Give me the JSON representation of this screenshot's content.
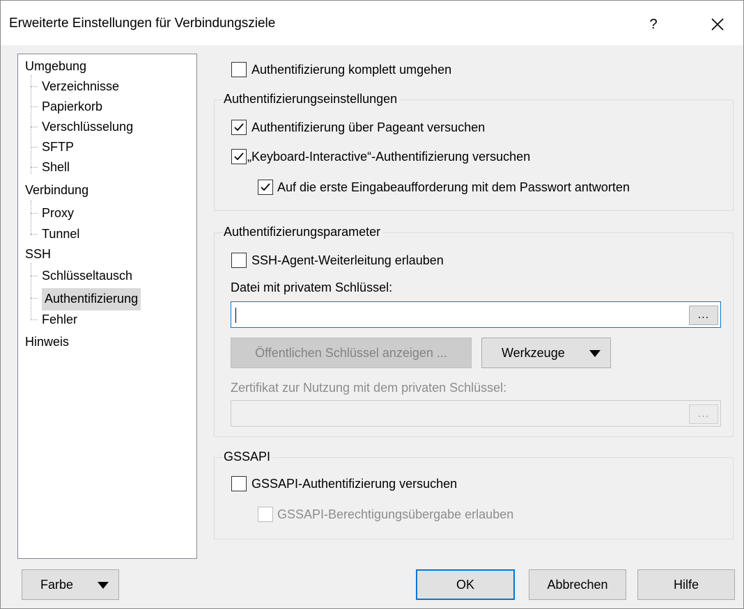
{
  "window": {
    "title": "Erweiterte Einstellungen für Verbindungsziele",
    "help_label": "?"
  },
  "tree": {
    "items": [
      "Umgebung",
      "Verzeichnisse",
      "Papierkorb",
      "Verschlüsselung",
      "SFTP",
      "Shell",
      "Verbindung",
      "Proxy",
      "Tunnel",
      "SSH",
      "Schlüsseltausch",
      "Authentifizierung",
      "Fehler",
      "Hinweis"
    ],
    "selected": "Authentifizierung"
  },
  "auth": {
    "bypass": {
      "label": "Authentifizierung komplett umgehen",
      "checked": false
    }
  },
  "settings_group": {
    "title": "Authentifizierungseinstellungen",
    "pageant": {
      "label": "Authentifizierung über Pageant versuchen",
      "checked": true
    },
    "keyboard_interactive": {
      "label": "„Keyboard-Interactive“-Authentifizierung versuchen",
      "checked": true
    },
    "respond_password": {
      "label": "Auf die erste Eingabeaufforderung mit dem Passwort antworten",
      "checked": true
    }
  },
  "params_group": {
    "title": "Authentifizierungsparameter",
    "agent_forwarding": {
      "label": "SSH-Agent-Weiterleitung erlauben",
      "checked": false
    },
    "private_key_label": "Datei mit privatem Schlüssel:",
    "private_key_value": "",
    "browse_label": "...",
    "show_public_key_label": "Öffentlichen Schlüssel anzeigen ...",
    "tools_label": "Werkzeuge",
    "certificate_label": "Zertifikat zur Nutzung mit dem privaten Schlüssel:",
    "certificate_value": "",
    "cert_browse_label": "..."
  },
  "gssapi_group": {
    "title": "GSSAPI",
    "gssapi_auth": {
      "label": "GSSAPI-Authentifizierung versuchen",
      "checked": false
    },
    "gssapi_delegation": {
      "label": "GSSAPI-Berechtigungsübergabe erlauben",
      "checked": false
    }
  },
  "footer": {
    "color_label": "Farbe",
    "ok_label": "OK",
    "cancel_label": "Abbrechen",
    "help_label": "Hilfe"
  },
  "colors": {
    "accent": "#0078d7",
    "selection": "#d9d9d9",
    "disabled_text": "#8d8d8d"
  }
}
